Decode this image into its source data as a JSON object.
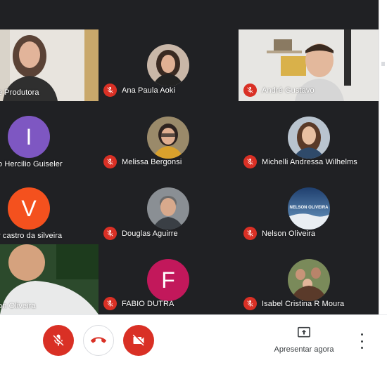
{
  "participants": [
    {
      "name": "e Produtora",
      "avatar": "photo",
      "muted": false
    },
    {
      "name": "Ana Paula Aoki",
      "avatar": "photo",
      "muted": true
    },
    {
      "name": "André Gustavo",
      "avatar": "photo",
      "muted": true
    },
    {
      "name": "o Hercilio Guiseler",
      "avatar": "initial",
      "initial": "I",
      "color": "#7e57c2",
      "muted": false
    },
    {
      "name": "Melissa Bergonsi",
      "avatar": "photo",
      "muted": true
    },
    {
      "name": "Michelli Andressa Wilhelms",
      "avatar": "photo",
      "muted": true
    },
    {
      "name": "r castro da silveira",
      "avatar": "initial",
      "initial": "V",
      "color": "#f4511e",
      "muted": false
    },
    {
      "name": "Douglas Aguirre",
      "avatar": "photo",
      "muted": true
    },
    {
      "name": "Nelson Oliveira",
      "avatar": "photo",
      "muted": true,
      "avatar_text": "NELSON OLIVEIRA"
    },
    {
      "name": "on Oliveira",
      "avatar": "photo",
      "muted": false
    },
    {
      "name": "FABIO DUTRA",
      "avatar": "initial",
      "initial": "F",
      "color": "#c2185b",
      "muted": true
    },
    {
      "name": "Isabel Cristina R Moura",
      "avatar": "photo",
      "muted": true
    }
  ],
  "controls": {
    "present_label": "Apresentar agora",
    "mic_icon": "mic-off-icon",
    "hangup_icon": "call-end-icon",
    "camera_icon": "videocam-off-icon",
    "present_icon": "present-to-all-icon",
    "more_icon": "more-vert-icon"
  },
  "colors": {
    "background": "#202124",
    "tile": "#3c4043",
    "danger": "#d93025"
  }
}
